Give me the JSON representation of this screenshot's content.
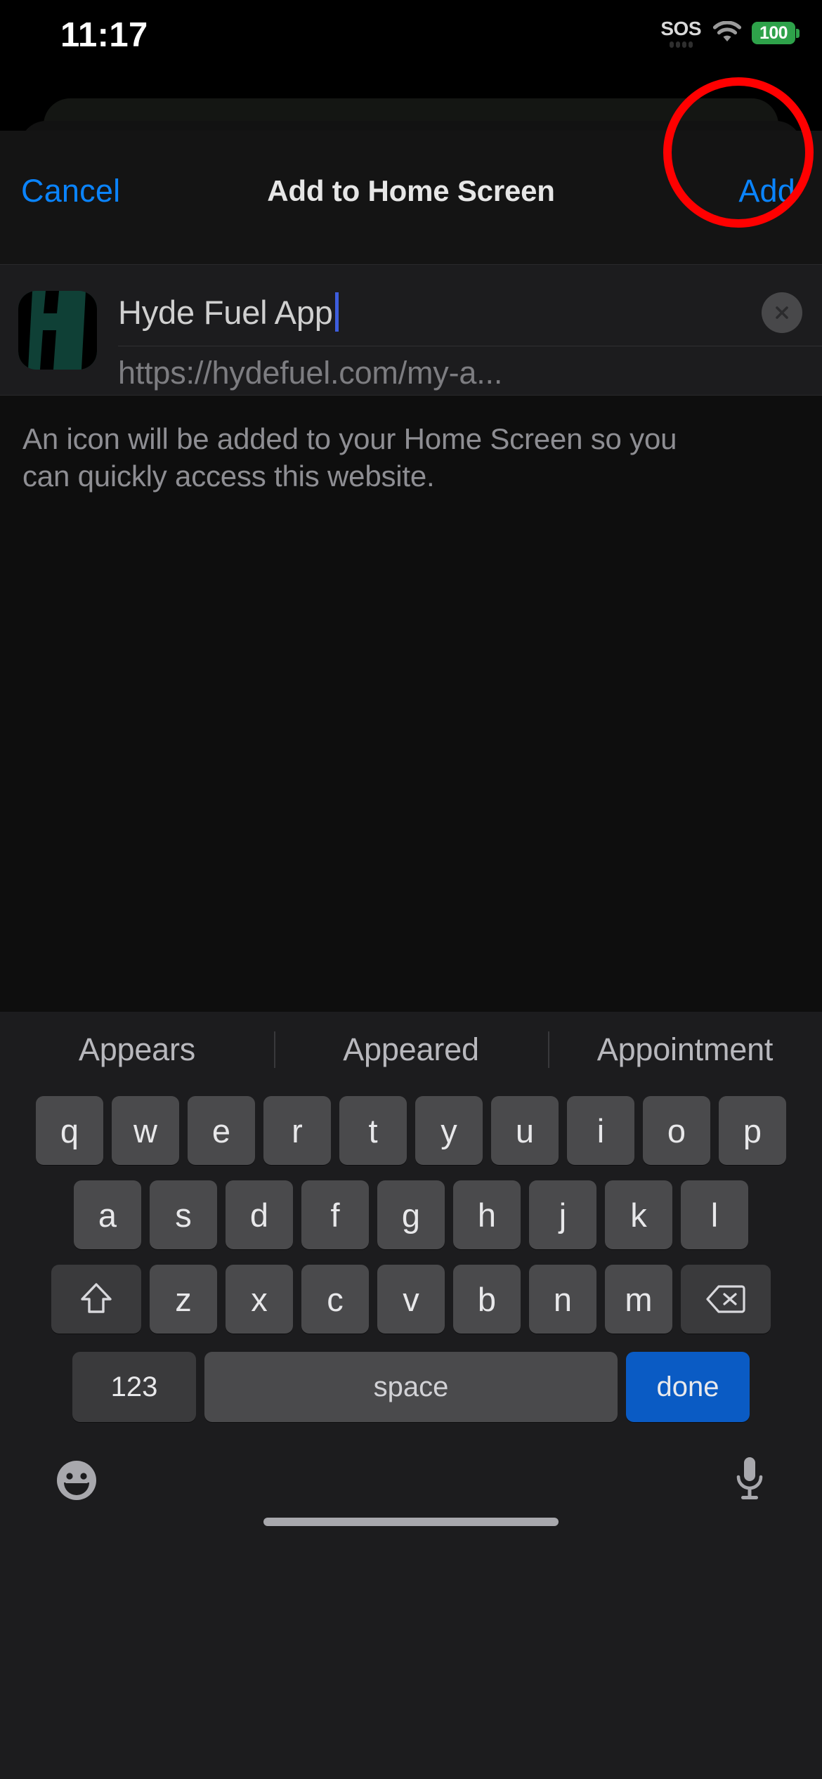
{
  "status_bar": {
    "time": "11:17",
    "sos_label": "SOS",
    "battery_level": "100",
    "battery_color": "#2ea24a",
    "wifi_icon": "wifi-icon"
  },
  "sheet": {
    "cancel_label": "Cancel",
    "title": "Add to Home Screen",
    "add_label": "Add",
    "accent_color": "#0a84ff",
    "highlight_color": "#ff0000"
  },
  "form": {
    "icon": {
      "name": "hyde-fuel-app-icon",
      "letter": "H",
      "background_color": "#0f4036",
      "glyph_color": "#000000"
    },
    "name_field": {
      "value": "Hyde Fuel App",
      "placeholder": "Name",
      "caret_color": "#3d5ddd"
    },
    "url_field": {
      "value": "https://hydefuel.com/my-a...",
      "placeholder": "URL"
    },
    "clear_button": "clear-text-icon"
  },
  "footer": {
    "note": "An icon will be added to your Home Screen so you can quickly access this website."
  },
  "keyboard": {
    "suggestions": [
      "Appears",
      "Appeared",
      "Appointment"
    ],
    "row1": [
      "q",
      "w",
      "e",
      "r",
      "t",
      "y",
      "u",
      "i",
      "o",
      "p"
    ],
    "row2": [
      "a",
      "s",
      "d",
      "f",
      "g",
      "h",
      "j",
      "k",
      "l"
    ],
    "row3_letters": [
      "z",
      "x",
      "c",
      "v",
      "b",
      "n",
      "m"
    ],
    "shift_key": "shift-icon",
    "backspace_key": "backspace-icon",
    "numbers_key": "123",
    "space_key": "space",
    "return_key": "done",
    "return_key_color": "#0a5bc4",
    "emoji_key": "emoji-icon",
    "dictation_key": "microphone-icon"
  }
}
